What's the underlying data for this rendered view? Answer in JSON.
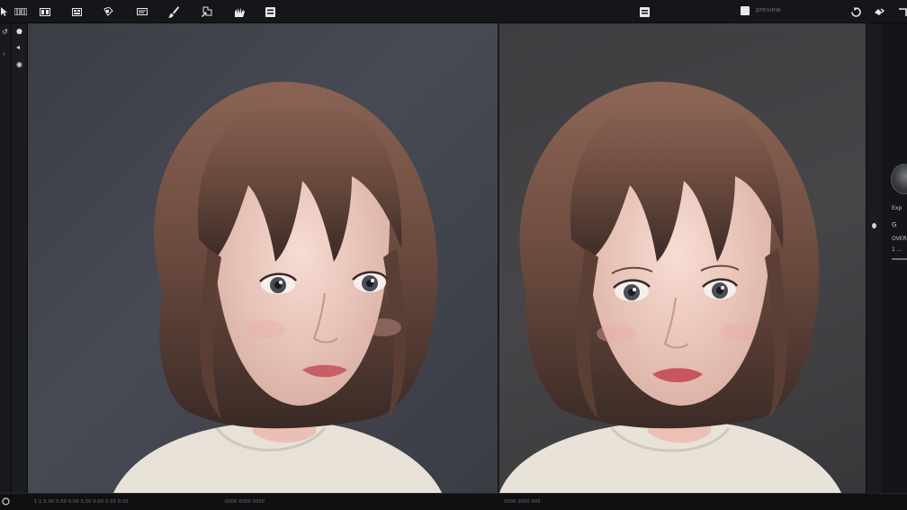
{
  "toolbar": {
    "buttons": [
      {
        "name": "select-tool",
        "icon": "cursor-icon"
      },
      {
        "name": "grid-view",
        "label": "▥▥"
      },
      {
        "name": "frames-view",
        "label": "▣▣"
      },
      {
        "name": "layers-view",
        "label": "▦"
      },
      {
        "name": "window-view",
        "label": "▭▭"
      },
      {
        "name": "brush-tool",
        "icon": "brush-icon"
      },
      {
        "name": "transform-tool",
        "icon": "transform-icon"
      },
      {
        "name": "hand-tool",
        "icon": "hand-icon"
      },
      {
        "name": "panel-toggle",
        "icon": "panel-icon"
      },
      {
        "name": "document-toggle",
        "icon": "document-icon"
      },
      {
        "name": "undo",
        "icon": "undo-icon"
      },
      {
        "name": "redo",
        "icon": "redo-icon"
      }
    ],
    "checkbox_label": "preview"
  },
  "left_rail": {
    "icons": [
      "arrow-icon",
      "gear-icon",
      "circle-icon",
      "pin-icon",
      "dot-icon"
    ]
  },
  "right_sidebar": {
    "items": [
      {
        "name": "label-1",
        "text": "Exp"
      },
      {
        "name": "label-2",
        "text": "G"
      },
      {
        "name": "label-3",
        "text": "OVER"
      },
      {
        "name": "label-4",
        "text": "1 ..."
      }
    ]
  },
  "status": {
    "left": "1:1 0.00  0.00 0.00 0.00 0.00 0.00 0.00",
    "mid": "0000  0000 0000",
    "right": "0000 0000 000"
  },
  "panels": [
    {
      "name": "original-view"
    },
    {
      "name": "edited-view"
    }
  ],
  "colors": {
    "toolbar": "#151619",
    "canvas_left": "#42444c",
    "canvas_right": "#414144",
    "hair": "#6e4c40",
    "skin": "#f2d2c6",
    "sweater": "#e6e0d6"
  }
}
